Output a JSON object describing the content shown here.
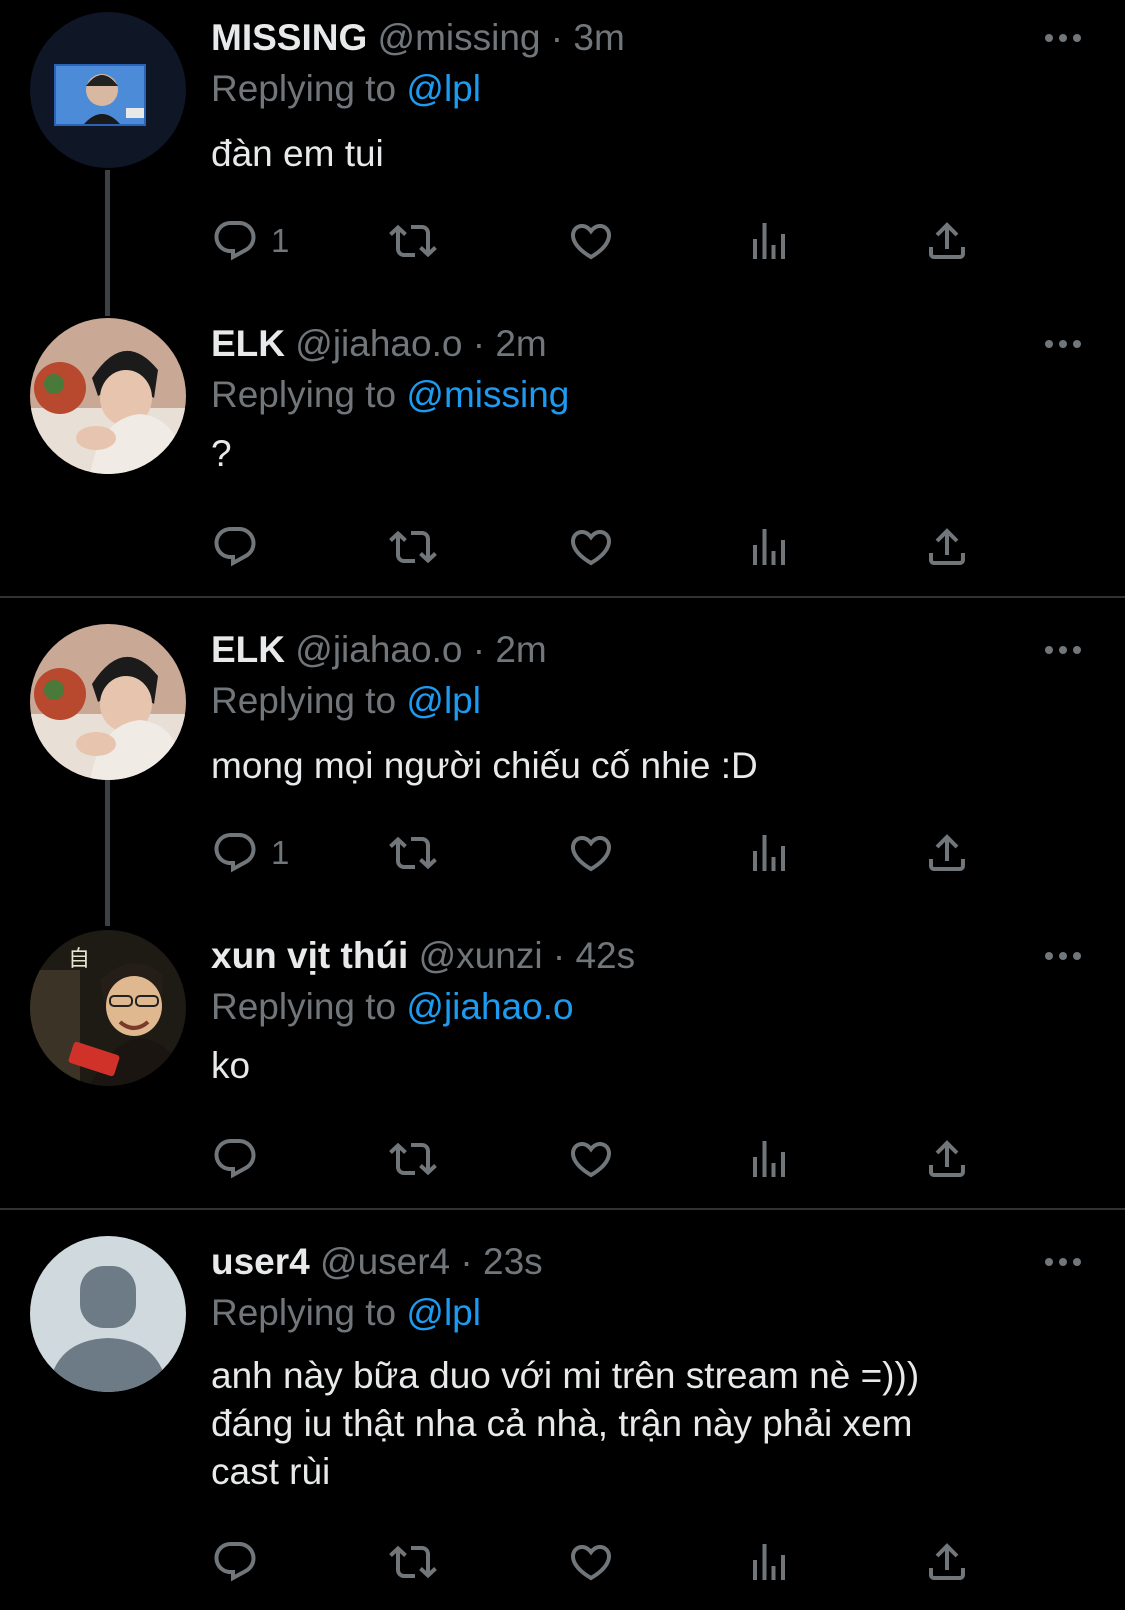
{
  "tweets": [
    {
      "name": "MISSING",
      "handle": "@missing",
      "dot": "·",
      "time": "3m",
      "replying_prefix": "Replying to",
      "replying_to": "@lpl",
      "text": "đàn em tui",
      "reply_count": "1",
      "avatar": "tv-screen-photo"
    },
    {
      "name": "ELK",
      "handle": "@jiahao.o",
      "dot": "·",
      "time": "2m",
      "replying_prefix": "Replying to",
      "replying_to": "@missing",
      "text": "?",
      "reply_count": "",
      "avatar": "person-photo"
    },
    {
      "name": "ELK",
      "handle": "@jiahao.o",
      "dot": "·",
      "time": "2m",
      "replying_prefix": "Replying to",
      "replying_to": "@lpl",
      "text": "mong mọi người chiếu cố nhie :D",
      "reply_count": "1",
      "avatar": "person-photo"
    },
    {
      "name": "xun vịt thúi",
      "handle": "@xunzi",
      "dot": "·",
      "time": "42s",
      "replying_prefix": "Replying to",
      "replying_to": "@jiahao.o",
      "text": "ko",
      "reply_count": "",
      "avatar": "person-photo",
      "avatar_glyph": "自"
    },
    {
      "name": "user4",
      "handle": "@user4",
      "dot": "·",
      "time": "23s",
      "replying_prefix": "Replying to",
      "replying_to": "@lpl",
      "text": "anh này bữa duo với mi trên stream nè =)))\nđáng iu thật nha cả nhà, trận này phải xem\ncast rùi",
      "reply_count": "",
      "avatar": "default-avatar"
    }
  ],
  "icons": {
    "reply": "reply-icon",
    "retweet": "retweet-icon",
    "like": "heart-icon",
    "views": "views-icon",
    "share": "share-icon",
    "more": "more-icon"
  },
  "colors": {
    "background": "#000000",
    "text": "#e7e9ea",
    "secondary": "#71767b",
    "accent": "#1d9bf0",
    "divider": "#2f3336"
  }
}
